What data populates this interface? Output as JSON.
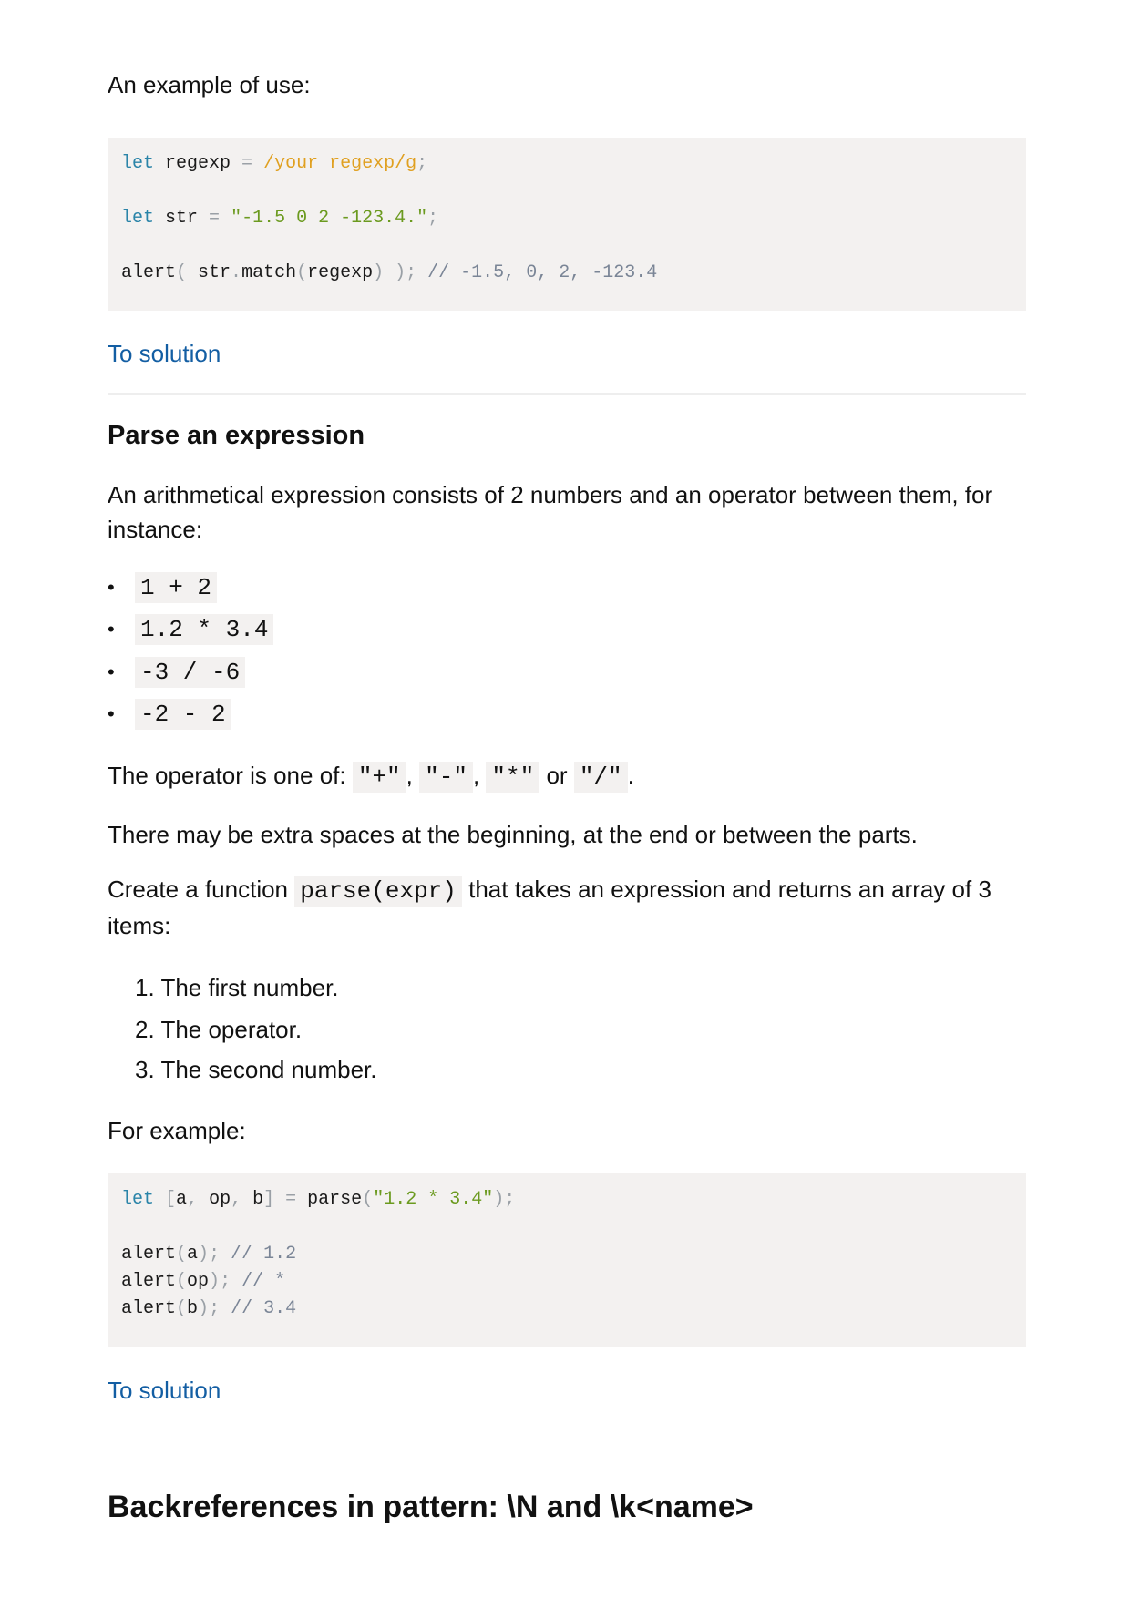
{
  "intro_text": "An example of use:",
  "code1": [
    [
      {
        "t": "let",
        "c": "kw"
      },
      {
        "t": " regexp ",
        "c": ""
      },
      {
        "t": "=",
        "c": "pun"
      },
      {
        "t": " ",
        "c": ""
      },
      {
        "t": "/your regexp/g",
        "c": "rx"
      },
      {
        "t": ";",
        "c": "pun"
      }
    ],
    [],
    [
      {
        "t": "let",
        "c": "kw"
      },
      {
        "t": " str ",
        "c": ""
      },
      {
        "t": "=",
        "c": "pun"
      },
      {
        "t": " ",
        "c": ""
      },
      {
        "t": "\"-1.5 0 2 -123.4.\"",
        "c": "str"
      },
      {
        "t": ";",
        "c": "pun"
      }
    ],
    [],
    [
      {
        "t": "alert",
        "c": ""
      },
      {
        "t": "(",
        "c": "pun"
      },
      {
        "t": " str",
        "c": ""
      },
      {
        "t": ".",
        "c": "pun"
      },
      {
        "t": "match",
        "c": ""
      },
      {
        "t": "(",
        "c": "pun"
      },
      {
        "t": "regexp",
        "c": ""
      },
      {
        "t": ")",
        "c": "pun"
      },
      {
        "t": " ",
        "c": ""
      },
      {
        "t": ")",
        "c": "pun"
      },
      {
        "t": ";",
        "c": "pun"
      },
      {
        "t": " // -1.5, 0, 2, -123.4",
        "c": "cmt"
      }
    ]
  ],
  "link1": "To solution",
  "section_title": "Parse an expression",
  "para1": "An arithmetical expression consists of 2 numbers and an operator between them, for instance:",
  "bullets": [
    "1 + 2",
    "1.2 * 3.4",
    "-3 / -6",
    "-2 - 2"
  ],
  "operator_line": {
    "prefix": "The operator is one of:",
    "ops": [
      "\"+\"",
      "\"-\"",
      "\"*\"",
      "\"/\""
    ],
    "comma": ",",
    "or": "or",
    "period": "."
  },
  "para_spaces": "There may be extra spaces at the beginning, at the end or between the parts.",
  "create_line": {
    "before": "Create a function",
    "code": "parse(expr)",
    "after": "that takes an expression and returns an array of 3",
    "wrap": "items:"
  },
  "numbered": [
    "The first number.",
    "The operator.",
    "The second number."
  ],
  "for_example": "For example:",
  "code2": [
    [
      {
        "t": "let",
        "c": "kw"
      },
      {
        "t": " ",
        "c": ""
      },
      {
        "t": "[",
        "c": "pun"
      },
      {
        "t": "a",
        "c": ""
      },
      {
        "t": ",",
        "c": "pun"
      },
      {
        "t": " op",
        "c": ""
      },
      {
        "t": ",",
        "c": "pun"
      },
      {
        "t": " b",
        "c": ""
      },
      {
        "t": "]",
        "c": "pun"
      },
      {
        "t": " ",
        "c": ""
      },
      {
        "t": "=",
        "c": "pun"
      },
      {
        "t": " parse",
        "c": ""
      },
      {
        "t": "(",
        "c": "pun"
      },
      {
        "t": "\"1.2 * 3.4\"",
        "c": "str"
      },
      {
        "t": ")",
        "c": "pun"
      },
      {
        "t": ";",
        "c": "pun"
      }
    ],
    [],
    [
      {
        "t": "alert",
        "c": ""
      },
      {
        "t": "(",
        "c": "pun"
      },
      {
        "t": "a",
        "c": ""
      },
      {
        "t": ")",
        "c": "pun"
      },
      {
        "t": ";",
        "c": "pun"
      },
      {
        "t": " // 1.2",
        "c": "cmt"
      }
    ],
    [
      {
        "t": "alert",
        "c": ""
      },
      {
        "t": "(",
        "c": "pun"
      },
      {
        "t": "op",
        "c": ""
      },
      {
        "t": ")",
        "c": "pun"
      },
      {
        "t": ";",
        "c": "pun"
      },
      {
        "t": " // *",
        "c": "cmt"
      }
    ],
    [
      {
        "t": "alert",
        "c": ""
      },
      {
        "t": "(",
        "c": "pun"
      },
      {
        "t": "b",
        "c": ""
      },
      {
        "t": ")",
        "c": "pun"
      },
      {
        "t": ";",
        "c": "pun"
      },
      {
        "t": " // 3.4",
        "c": "cmt"
      }
    ]
  ],
  "link2": "To solution",
  "next_heading": "Backreferences in pattern: \\N and \\k<name>"
}
